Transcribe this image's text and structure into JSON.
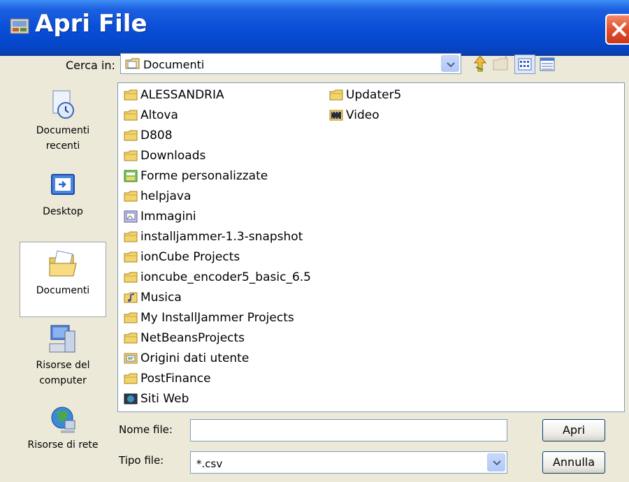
{
  "window": {
    "title": "Apri File"
  },
  "toolbar": {
    "look_in_label": "Cerca in:",
    "look_in_value": "Documenti",
    "icons": [
      "up-folder-icon",
      "new-folder-icon",
      "list-view-icon",
      "details-view-icon"
    ]
  },
  "sidebar": {
    "items": [
      {
        "label": "Documenti recenti",
        "icon": "recent-documents-icon"
      },
      {
        "label": "Desktop",
        "icon": "desktop-icon"
      },
      {
        "label": "Documenti",
        "icon": "documents-icon",
        "selected": true
      },
      {
        "label": "Risorse del computer",
        "icon": "my-computer-icon"
      },
      {
        "label": "Risorse di rete",
        "icon": "network-icon"
      }
    ]
  },
  "files": [
    {
      "name": "ALESSANDRIA",
      "icon": "folder"
    },
    {
      "name": "Altova",
      "icon": "folder"
    },
    {
      "name": "D808",
      "icon": "folder"
    },
    {
      "name": "Downloads",
      "icon": "folder"
    },
    {
      "name": "Forme personalizzate",
      "icon": "special-folder"
    },
    {
      "name": "helpjava",
      "icon": "folder"
    },
    {
      "name": "Immagini",
      "icon": "pictures-folder"
    },
    {
      "name": "installjammer-1.3-snapshot",
      "icon": "folder"
    },
    {
      "name": "ionCube Projects",
      "icon": "folder"
    },
    {
      "name": "ioncube_encoder5_basic_6.5",
      "icon": "folder"
    },
    {
      "name": "Musica",
      "icon": "music-folder"
    },
    {
      "name": "My InstallJammer Projects",
      "icon": "folder"
    },
    {
      "name": "NetBeansProjects",
      "icon": "folder"
    },
    {
      "name": "Origini dati utente",
      "icon": "data-sources-folder"
    },
    {
      "name": "PostFinance",
      "icon": "folder"
    },
    {
      "name": "Siti Web",
      "icon": "web-folder"
    },
    {
      "name": "Updater5",
      "icon": "folder"
    },
    {
      "name": "Video",
      "icon": "video-folder"
    }
  ],
  "filename": {
    "label": "Nome file:",
    "value": ""
  },
  "filetype": {
    "label": "Tipo file:",
    "value": "*.csv"
  },
  "buttons": {
    "open": "Apri",
    "cancel": "Annulla"
  },
  "colors": {
    "titlebar": "#0a4fd8",
    "background": "#ece9d8",
    "folder": "#f3d36b",
    "close": "#e2502c"
  }
}
